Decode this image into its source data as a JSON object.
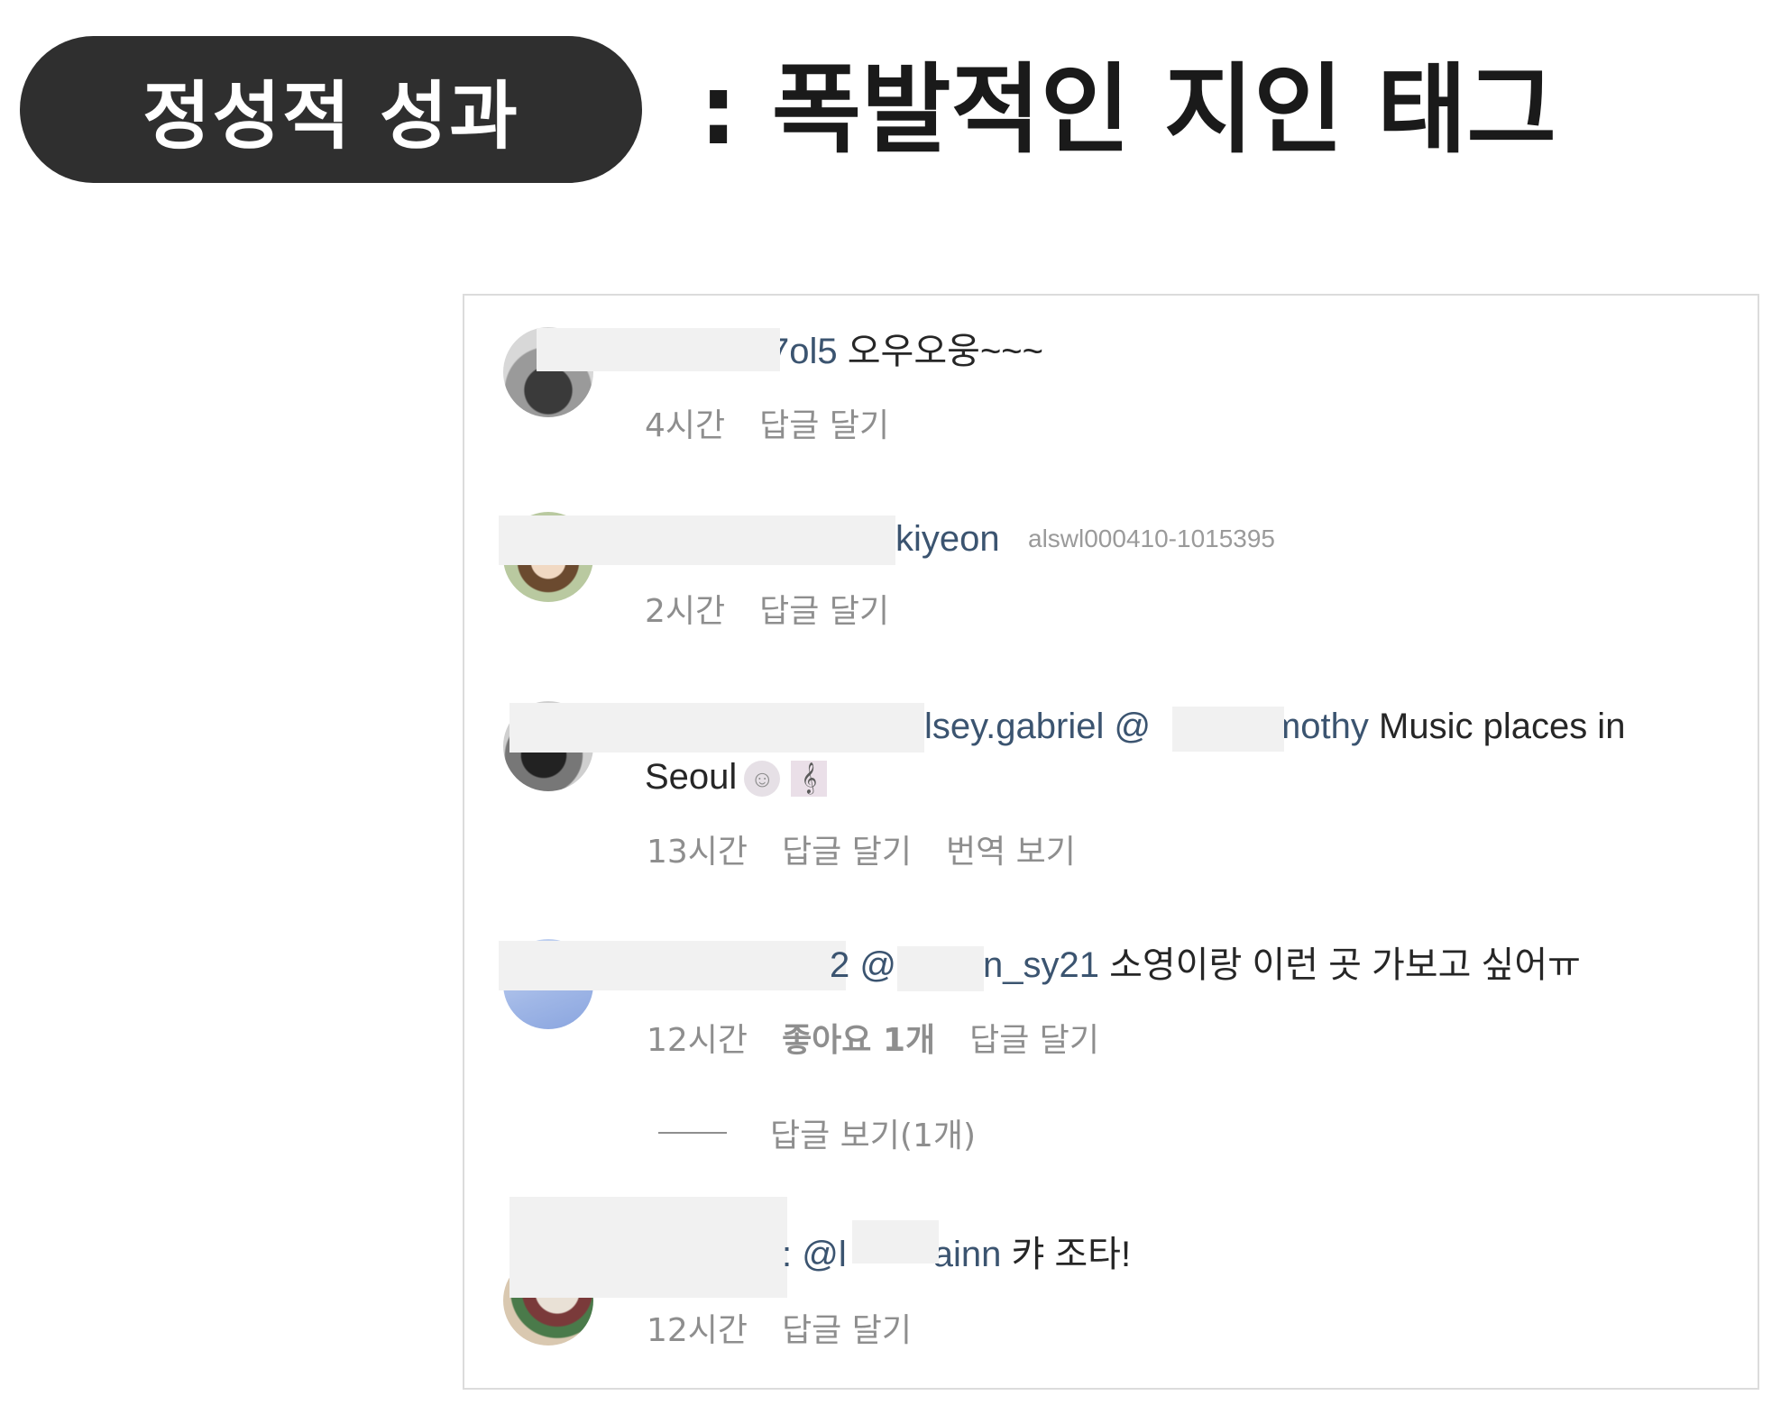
{
  "header": {
    "pill_label": "정성적 성과",
    "headline": ": 폭발적인 지인 태그"
  },
  "comments": [
    {
      "username_visible": "7ol5",
      "text": " 오우오웅~~~",
      "time": "4시간",
      "reply": "답글 달기"
    },
    {
      "username_visible": "kiyeon",
      "watermark": "alswl000410-1015395",
      "time": "2시간",
      "reply": "답글 달기"
    },
    {
      "username_visible": "lsey.gabriel",
      "mention_prefix": " @",
      "mention_visible": "imothy",
      "text": " Music places in",
      "text_line2": "Seoul",
      "time": "13시간",
      "reply": "답글 달기",
      "translate": "번역 보기"
    },
    {
      "username_visible": "2",
      "mention_prefix": " @",
      "mention_visible": "n_sy21",
      "text": " 소영이랑 이런 곳 가보고 싶어ㅠ",
      "time": "12시간",
      "likes": "좋아요 1개",
      "reply": "답글 달기",
      "view_replies": "답글 보기(1개)"
    },
    {
      "username_visible": ":",
      "mention_prefix": " @l",
      "mention_visible": "ainn",
      "text": " 캬 조타!",
      "time": "12시간",
      "reply": "답글 달기"
    }
  ]
}
